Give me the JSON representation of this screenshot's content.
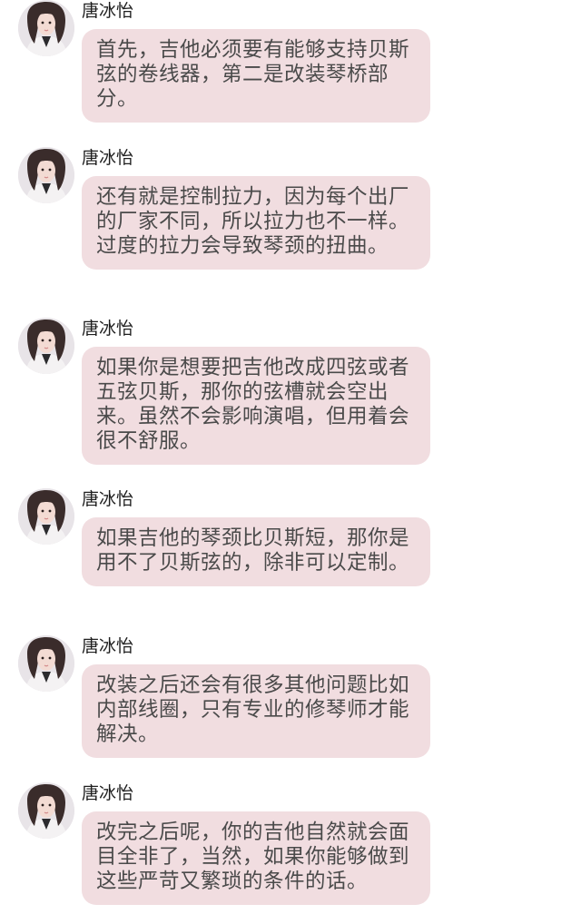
{
  "messages": [
    {
      "sender": "唐冰怡",
      "text": "首先，吉他必须要有能够支持贝斯弦的卷线器，第二是改装琴桥部分。"
    },
    {
      "sender": "唐冰怡",
      "text": "还有就是控制拉力，因为每个出厂的厂家不同，所以拉力也不一样。过度的拉力会导致琴颈的扭曲。"
    },
    {
      "sender": "唐冰怡",
      "text": "如果你是想要把吉他改成四弦或者五弦贝斯，那你的弦槽就会空出来。虽然不会影响演唱，但用着会很不舒服。"
    },
    {
      "sender": "唐冰怡",
      "text": "如果吉他的琴颈比贝斯短，那你是用不了贝斯弦的，除非可以定制。"
    },
    {
      "sender": "唐冰怡",
      "text": "改装之后还会有很多其他问题比如内部线圈，只有专业的修琴师才能解决。"
    },
    {
      "sender": "唐冰怡",
      "text": "改完之后呢，你的吉他自然就会面目全非了，当然，如果你能够做到这些严苛又繁琐的条件的话。"
    }
  ],
  "colors": {
    "bubble": "#f1dde0",
    "text": "#4a4a4a",
    "name": "#1e1e1e"
  }
}
